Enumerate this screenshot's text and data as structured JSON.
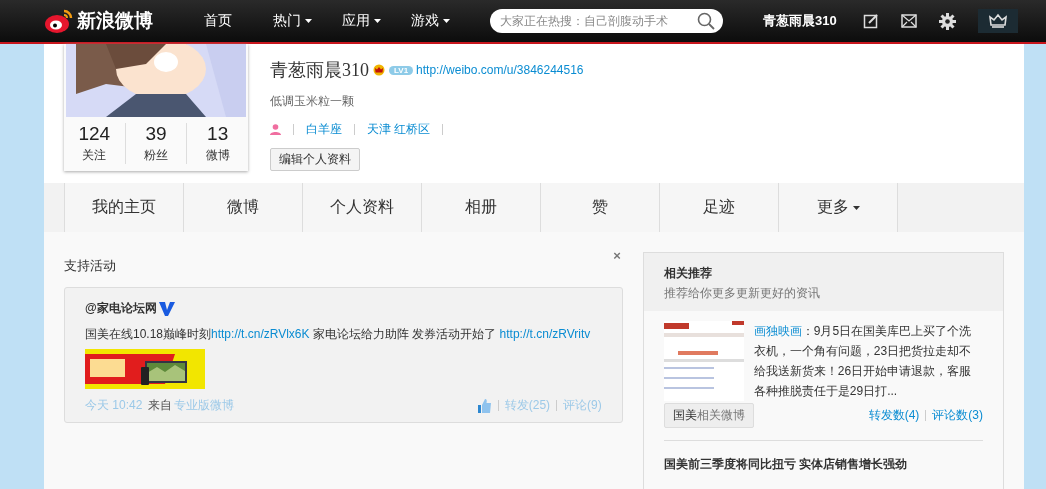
{
  "top_bar": {
    "logo": "新浪微博",
    "nav": [
      {
        "label": "首页",
        "dropdown": false
      },
      {
        "label": "热门",
        "dropdown": true
      },
      {
        "label": "应用",
        "dropdown": true
      },
      {
        "label": "游戏",
        "dropdown": true
      }
    ],
    "search": {
      "placeholder": "大家正在热搜：自己剖腹动手术"
    },
    "username": "青葱雨晨310"
  },
  "profile": {
    "name": "青葱雨晨310",
    "level_badge": "LV1",
    "url": "http://weibo.com/u/3846244516",
    "bio": "低调玉米粒一颗",
    "zodiac": "白羊座",
    "location": "天津 红桥区",
    "edit_button": "编辑个人资料",
    "stats": [
      {
        "value": "124",
        "label": "关注"
      },
      {
        "value": "39",
        "label": "粉丝"
      },
      {
        "value": "13",
        "label": "微博"
      }
    ]
  },
  "tabs": [
    {
      "label": "我的主页",
      "selected": false,
      "dropdown": false
    },
    {
      "label": "微博",
      "selected": false,
      "dropdown": false
    },
    {
      "label": "个人资料",
      "selected": false,
      "dropdown": false
    },
    {
      "label": "相册",
      "selected": false,
      "dropdown": false
    },
    {
      "label": "赞",
      "selected": false,
      "dropdown": false
    },
    {
      "label": "足迹",
      "selected": false,
      "dropdown": false
    },
    {
      "label": "更多",
      "selected": false,
      "dropdown": true
    }
  ],
  "activity": {
    "title": "支持活动",
    "close": "×",
    "post": {
      "author": "@家电论坛网",
      "verified": true,
      "text": [
        {
          "kind": "text",
          "text": "国美在线10.18巅峰时刻"
        },
        {
          "kind": "link",
          "text": "http://t.cn/zRVlx6K"
        },
        {
          "kind": "text",
          "text": " 家电论坛给力助阵 发券活动开始了 "
        },
        {
          "kind": "link",
          "text": "http://t.cn/zRVritv"
        }
      ],
      "time": "今天 10:42",
      "source_prefix": "来自",
      "source": "专业版微博",
      "repost": "转发(25)",
      "comment": "评论(9)"
    }
  },
  "recommend": {
    "title": "相关推荐",
    "subtitle": "推荐给你更多更新更好的资讯",
    "items": [
      {
        "author": "画独映画",
        "text": "：9月5日在国美库巴上买了个洗衣机，一个角有问题，23日把货拉走却不给我送新货来！26日开始申请退款，客服各种推脱责任于是29日打...",
        "tag_prefix": "国美",
        "tag": "相关微博",
        "reposts": "转发数(4)",
        "comments": "评论数(3)"
      }
    ],
    "headline": "国美前三季度将同比扭亏 实体店销售增长强劲"
  }
}
